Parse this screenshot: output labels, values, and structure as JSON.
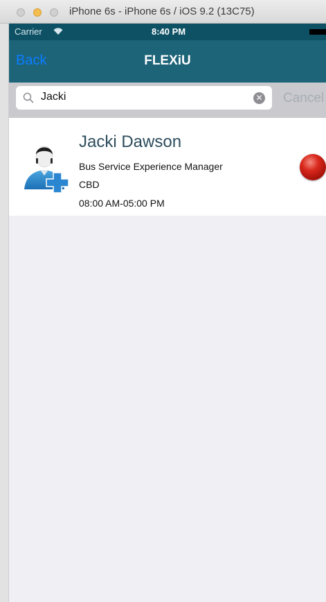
{
  "window": {
    "title": "iPhone 6s - iPhone 6s / iOS 9.2 (13C75)"
  },
  "status_bar": {
    "carrier": "Carrier",
    "time": "8:40 PM"
  },
  "nav": {
    "back_label": "Back",
    "title": "FLEXiU"
  },
  "search": {
    "value": "Jacki",
    "cancel_label": "Cancel"
  },
  "results": [
    {
      "name": "Jacki Dawson",
      "title": "Bus Service Experience Manager",
      "location": "CBD",
      "hours": "08:00 AM-05:00 PM",
      "status_color": "#c8120a"
    }
  ],
  "colors": {
    "nav_bar": "#1d6479",
    "status_bar": "#0e5165",
    "back_link": "#0b7dff",
    "name_text": "#2c4c5c"
  }
}
